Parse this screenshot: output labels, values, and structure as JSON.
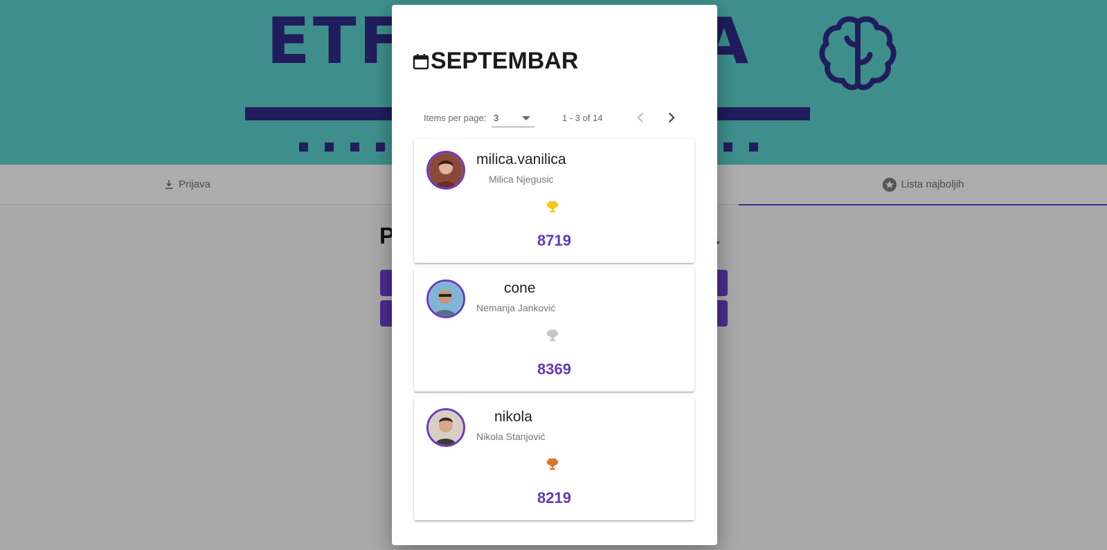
{
  "app": {
    "title_left": "ETF",
    "title_right": "KA",
    "brand_color": "#211c5c",
    "hero_color": "#3e8f8c",
    "accent_color": "#6537b8"
  },
  "tabs": [
    {
      "label": "Prijava",
      "icon": "download-icon"
    },
    {
      "label": "Lista najboljih",
      "icon": "star-circle-icon",
      "active": true
    }
  ],
  "page": {
    "heading_left": "P",
    "heading_right": "a"
  },
  "dialog": {
    "title": "SEPTEMBAR",
    "title_icon": "calendar-icon",
    "paginator": {
      "items_per_page_label": "Items per page:",
      "items_per_page_value": "3",
      "range_label": "1 - 3 of 14"
    },
    "entries": [
      {
        "username": "milica.vanilica",
        "full_name": "Milica Njegusic",
        "score": "8719",
        "trophy": "gold",
        "trophy_color": "#f5c518"
      },
      {
        "username": "cone",
        "full_name": "Nemanja Janković",
        "score": "8369",
        "trophy": "silver",
        "trophy_color": "#c4c4c4"
      },
      {
        "username": "nikola",
        "full_name": "Nikola Stanjović",
        "score": "8219",
        "trophy": "bronze",
        "trophy_color": "#d9772b"
      }
    ]
  }
}
